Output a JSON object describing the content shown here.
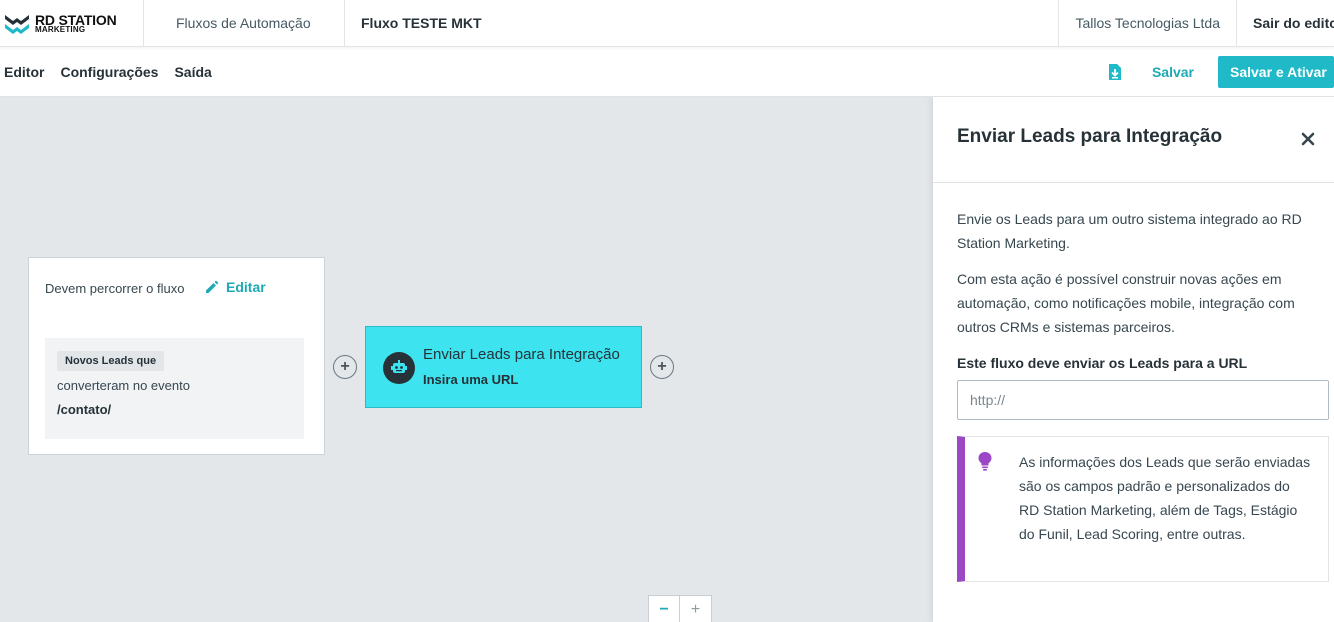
{
  "header": {
    "logo_line1": "RD STATION",
    "logo_line2": "MARKETING",
    "breadcrumb_parent": "Fluxos de Automação",
    "breadcrumb_current": "Fluxo TESTE MKT",
    "company": "Tallos Tecnologias Ltda",
    "exit_label": "Sair do editor"
  },
  "subbar": {
    "tabs": [
      "Editor",
      "Configurações",
      "Saída"
    ],
    "save_label": "Salvar",
    "save_activate_label": "Salvar e Ativar"
  },
  "canvas": {
    "trigger": {
      "title": "Devem percorrer o fluxo",
      "edit_label": "Editar",
      "tag": "Novos Leads que",
      "line": "converteram no evento",
      "event": "/contato/"
    },
    "action": {
      "title": "Enviar Leads para Integração",
      "subtitle": "Insira uma URL"
    },
    "zoom": {
      "minus": "−",
      "plus": "+"
    },
    "add_symbol": "+"
  },
  "panel": {
    "title": "Enviar Leads para Integração",
    "paragraph1": "Envie os Leads para um outro sistema integrado ao RD Station Marketing.",
    "paragraph2": "Com esta ação é possível construir novas ações em automação, como notificações mobile, integração com outros CRMs e sistemas parceiros.",
    "field_label": "Este fluxo deve enviar os Leads para a URL",
    "url_placeholder": "http://",
    "tip": "As informações dos Leads que serão enviadas são os campos padrão e personalizados do RD Station Marketing, além de Tags, Estágio do Funil, Lead Scoring, entre outras."
  },
  "colors": {
    "accent": "#1fb9c8",
    "action_card": "#3de3ee",
    "tip_border": "#9a48c6"
  },
  "icons": [
    "rd-logo-icon",
    "pencil-icon",
    "robot-icon",
    "plus-circle-icon",
    "download-icon",
    "close-icon",
    "lightbulb-icon"
  ]
}
